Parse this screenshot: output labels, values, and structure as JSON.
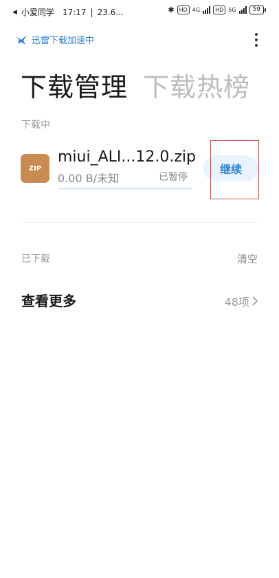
{
  "status_bar": {
    "carrier": "小爱同学",
    "time": "17:17",
    "extra": "23.6...",
    "network_tags": [
      "HD",
      "4G",
      "HD",
      "5G"
    ],
    "battery": "59"
  },
  "top_bar": {
    "accelerate_label": "迅雷下载加速中"
  },
  "tabs": [
    {
      "label": "下载管理",
      "active": true
    },
    {
      "label": "下载热榜",
      "active": false
    }
  ],
  "downloading": {
    "section_label": "下载中",
    "item": {
      "icon_text": "ZIP",
      "file_name": "miui_ALI...12.0.zip",
      "speed": "0.00 B/未知",
      "status": "已暂停",
      "progress_percent": 0,
      "action_label": "继续"
    }
  },
  "downloaded": {
    "section_label": "已下载",
    "clear_label": "清空",
    "view_more_label": "查看更多",
    "count_label": "48项"
  },
  "colors": {
    "accent": "#2f7fd0",
    "zip_icon_bg": "#c98b52",
    "highlight": "#c8504a"
  }
}
